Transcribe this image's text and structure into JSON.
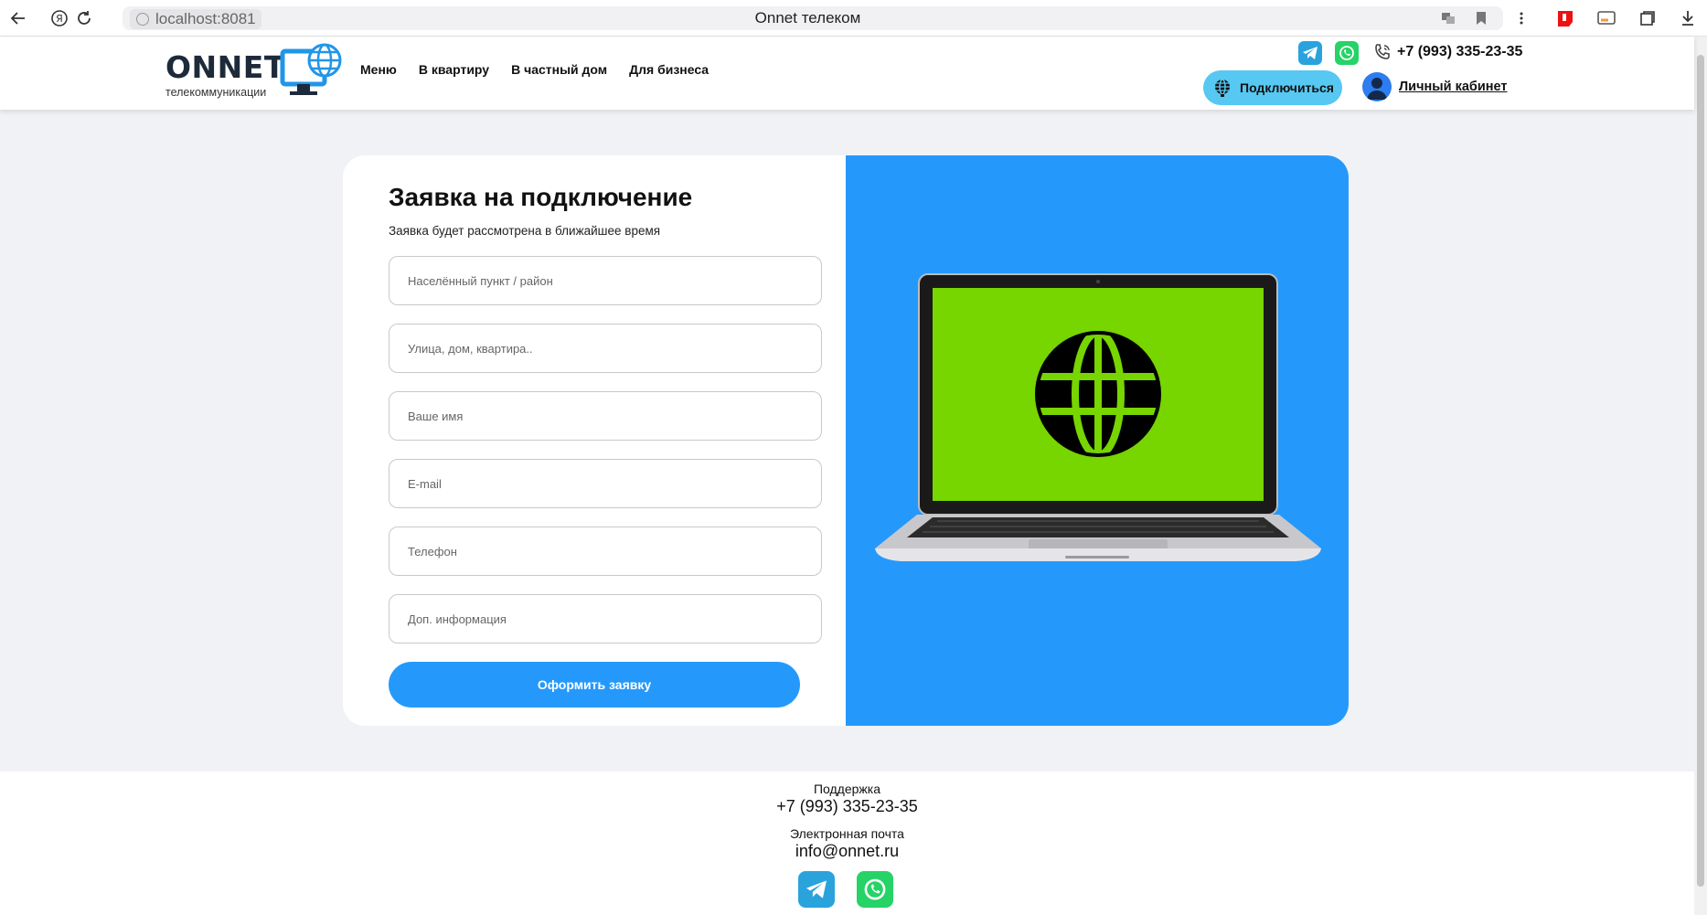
{
  "browser": {
    "url_host": "localhost:8081",
    "tab_title": "Onnet телеком"
  },
  "header": {
    "logo_text": "ONNET",
    "logo_subtitle": "телекоммуникации",
    "nav": [
      "Меню",
      "В квартиру",
      "В частный дом",
      "Для бизнеса"
    ],
    "phone": "+7 (993) 335-23-35",
    "connect_label": "Подключиться",
    "cabinet_label": "Личный кабинет"
  },
  "form": {
    "title": "Заявка на подключение",
    "subtitle": "Заявка будет рассмотрена в ближайшее время",
    "fields": [
      {
        "placeholder": "Населённый пункт / район"
      },
      {
        "placeholder": "Улица, дом, квартира.."
      },
      {
        "placeholder": "Ваше имя"
      },
      {
        "placeholder": "E-mail"
      },
      {
        "placeholder": "Телефон"
      },
      {
        "placeholder": "Доп. информация"
      }
    ],
    "submit_label": "Оформить заявку"
  },
  "footer": {
    "support_label": "Поддержка",
    "support_phone": "+7 (993) 335-23-35",
    "email_label": "Электронная почта",
    "email": "info@onnet.ru"
  },
  "colors": {
    "accent": "#2599fb",
    "connect_button": "#56c8f2",
    "screen_green": "#77d500",
    "telegram": "#2aa3dd",
    "whatsapp": "#25d366"
  },
  "icons": [
    "back-arrow-icon",
    "yandex-icon",
    "reload-icon",
    "telegram-icon",
    "whatsapp-icon",
    "phone-icon",
    "globe-icon",
    "user-icon",
    "laptop-icon"
  ]
}
